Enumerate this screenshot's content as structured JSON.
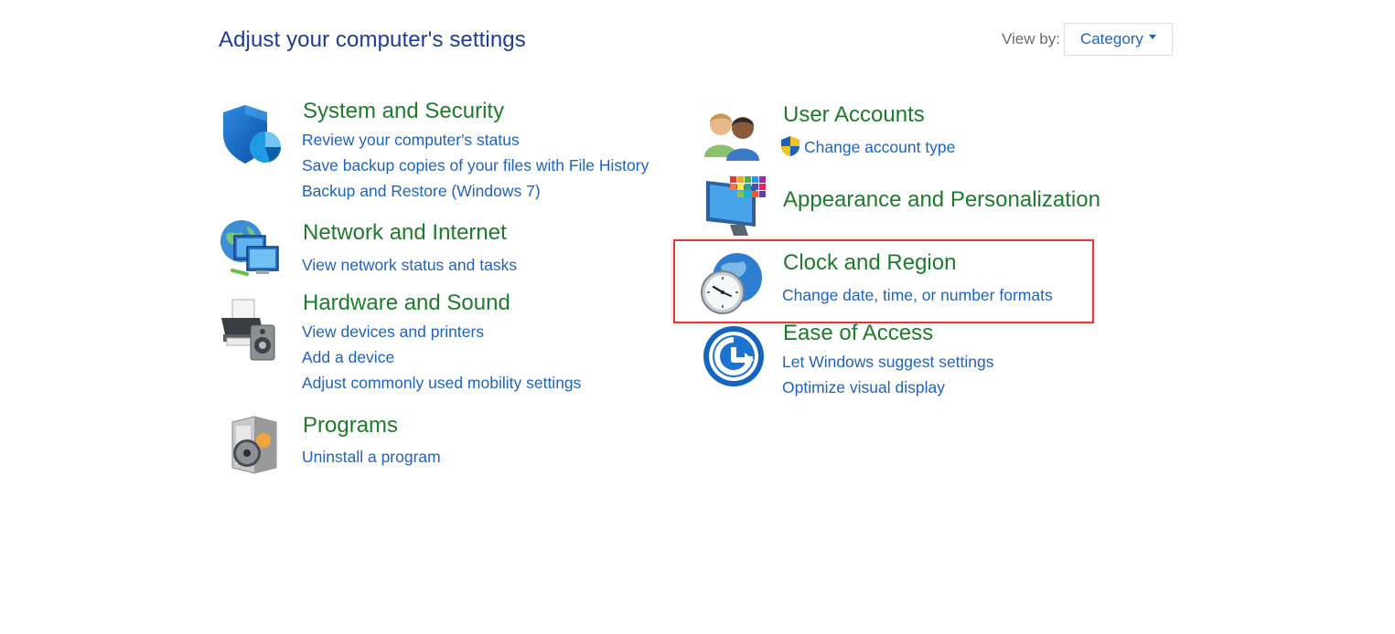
{
  "header": {
    "title": "Adjust your computer's settings",
    "view_by_label": "View by:",
    "view_by_value": "Category"
  },
  "categories": {
    "system_security": {
      "title": "System and Security",
      "icon": "shield-icon",
      "links": [
        "Review your computer's status",
        "Save backup copies of your files with File History",
        "Backup and Restore (Windows 7)"
      ]
    },
    "network_internet": {
      "title": "Network and Internet",
      "icon": "network-globe-icon",
      "links": [
        "View network status and tasks"
      ]
    },
    "hardware_sound": {
      "title": "Hardware and Sound",
      "icon": "printer-speaker-icon",
      "links": [
        "View devices and printers",
        "Add a device",
        "Adjust commonly used mobility settings"
      ]
    },
    "programs": {
      "title": "Programs",
      "icon": "programs-disc-icon",
      "links": [
        "Uninstall a program"
      ]
    },
    "user_accounts": {
      "title": "User Accounts",
      "icon": "users-icon",
      "links": [
        "Change account type"
      ]
    },
    "appearance": {
      "title": "Appearance and Personalization",
      "icon": "monitor-palette-icon",
      "links": []
    },
    "clock_region": {
      "title": "Clock and Region",
      "icon": "clock-globe-icon",
      "links": [
        "Change date, time, or number formats"
      ]
    },
    "ease_access": {
      "title": "Ease of Access",
      "icon": "ease-of-access-icon",
      "links": [
        "Let Windows suggest settings",
        "Optimize visual display"
      ]
    }
  },
  "colors": {
    "title_blue": "#1e3c96",
    "category_green": "#1e7b2c",
    "link_blue": "#1f63bd",
    "highlight_red": "#e0393c"
  }
}
